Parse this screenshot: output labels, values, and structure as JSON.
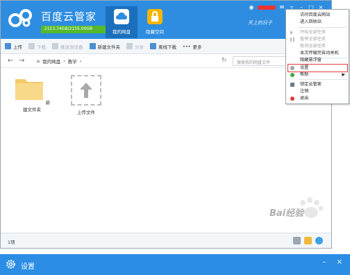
{
  "app": {
    "brand_title": "百度云管家",
    "quota_text": "2113.74GB/2155.00GB",
    "quota_fraction": 0.981,
    "signature": "天上的日子",
    "nav_tabs": [
      {
        "label": "我的网盘",
        "icon": "cloud-icon",
        "color": "#ffffff",
        "active": true
      },
      {
        "label": "隐藏空间",
        "icon": "lock-icon",
        "color": "#f7b500",
        "active": false
      }
    ]
  },
  "toolbar": {
    "buttons": [
      {
        "label": "上传",
        "icon": "upload-icon",
        "enabled": true
      },
      {
        "label": "下载",
        "icon": "download-icon",
        "enabled": false
      },
      {
        "label": "推送到设备",
        "icon": "push-icon",
        "enabled": false
      },
      {
        "label": "新建文件夹",
        "icon": "new-folder-icon",
        "enabled": true
      },
      {
        "label": "分享",
        "icon": "share-icon",
        "enabled": false
      },
      {
        "label": "离线下载",
        "icon": "offline-download-icon",
        "enabled": true
      },
      {
        "label": "更多",
        "icon": "more-icon",
        "enabled": true
      }
    ]
  },
  "pathbar": {
    "crumbs": [
      "我的网盘",
      "教学"
    ],
    "search_placeholder": "搜索我的网盘文件"
  },
  "files": [
    {
      "name": "新建文件夹",
      "type": "folder"
    },
    {
      "name": "上传文件",
      "type": "upload"
    }
  ],
  "status": {
    "count": "1项"
  },
  "menu": {
    "items": [
      {
        "label": "访问百度云网站",
        "enabled": true,
        "icon": null
      },
      {
        "label": "进入回收站",
        "enabled": true,
        "icon": null
      },
      {
        "label": "开始全部任务",
        "enabled": false,
        "icon": "play-icon"
      },
      {
        "label": "暂停全部任务",
        "enabled": false,
        "icon": "pause-icon"
      },
      {
        "label": "取消全部任务",
        "enabled": false,
        "icon": null
      },
      {
        "label": "本次传输完自动关机",
        "enabled": true,
        "icon": null
      },
      {
        "label": "隐藏悬浮窗",
        "enabled": true,
        "icon": null
      },
      {
        "label": "设置",
        "enabled": true,
        "icon": "gear-icon",
        "highlighted": true
      },
      {
        "label": "帮助",
        "enabled": true,
        "icon": "help-icon",
        "submenu": true
      },
      {
        "label": "锁定云管家",
        "enabled": true,
        "icon": "lock-icon"
      },
      {
        "label": "注销",
        "enabled": true,
        "icon": null
      },
      {
        "label": "退出",
        "enabled": true,
        "icon": "exit-icon"
      }
    ]
  },
  "settings_window": {
    "title": "设置"
  },
  "watermark": {
    "text": "Bai经验"
  },
  "colors": {
    "accent": "#2e8de0",
    "highlight": "#e23b3b",
    "quota_fill": "#55b92b"
  }
}
